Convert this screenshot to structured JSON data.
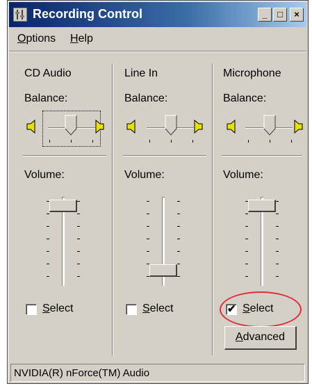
{
  "window": {
    "title": "Recording Control",
    "buttons": {
      "minimize": "_",
      "maximize": "□",
      "close": "×"
    }
  },
  "menu": {
    "options": {
      "accel": "O",
      "rest": "ptions"
    },
    "help": {
      "accel": "H",
      "rest": "elp"
    }
  },
  "channels": [
    {
      "name": "CD Audio",
      "balance_label": "Balance:",
      "volume_label": "Volume:",
      "volume_level": 0.95,
      "select": {
        "accel": "S",
        "rest": "elect",
        "checked": false
      }
    },
    {
      "name": "Line In",
      "balance_label": "Balance:",
      "volume_label": "Volume:",
      "volume_level": 0.1,
      "select": {
        "accel": "S",
        "rest": "elect",
        "checked": false
      }
    },
    {
      "name": "Microphone",
      "balance_label": "Balance:",
      "volume_label": "Volume:",
      "volume_level": 0.95,
      "select": {
        "accel": "S",
        "rest": "elect",
        "checked": true
      }
    }
  ],
  "advanced_button": {
    "accel": "A",
    "rest": "dvanced"
  },
  "status": "NVIDIA(R) nForce(TM) Audio",
  "colors": {
    "annotation": "#e0303a",
    "titlebar_start": "#0a246a",
    "titlebar_end": "#a6caf0"
  }
}
